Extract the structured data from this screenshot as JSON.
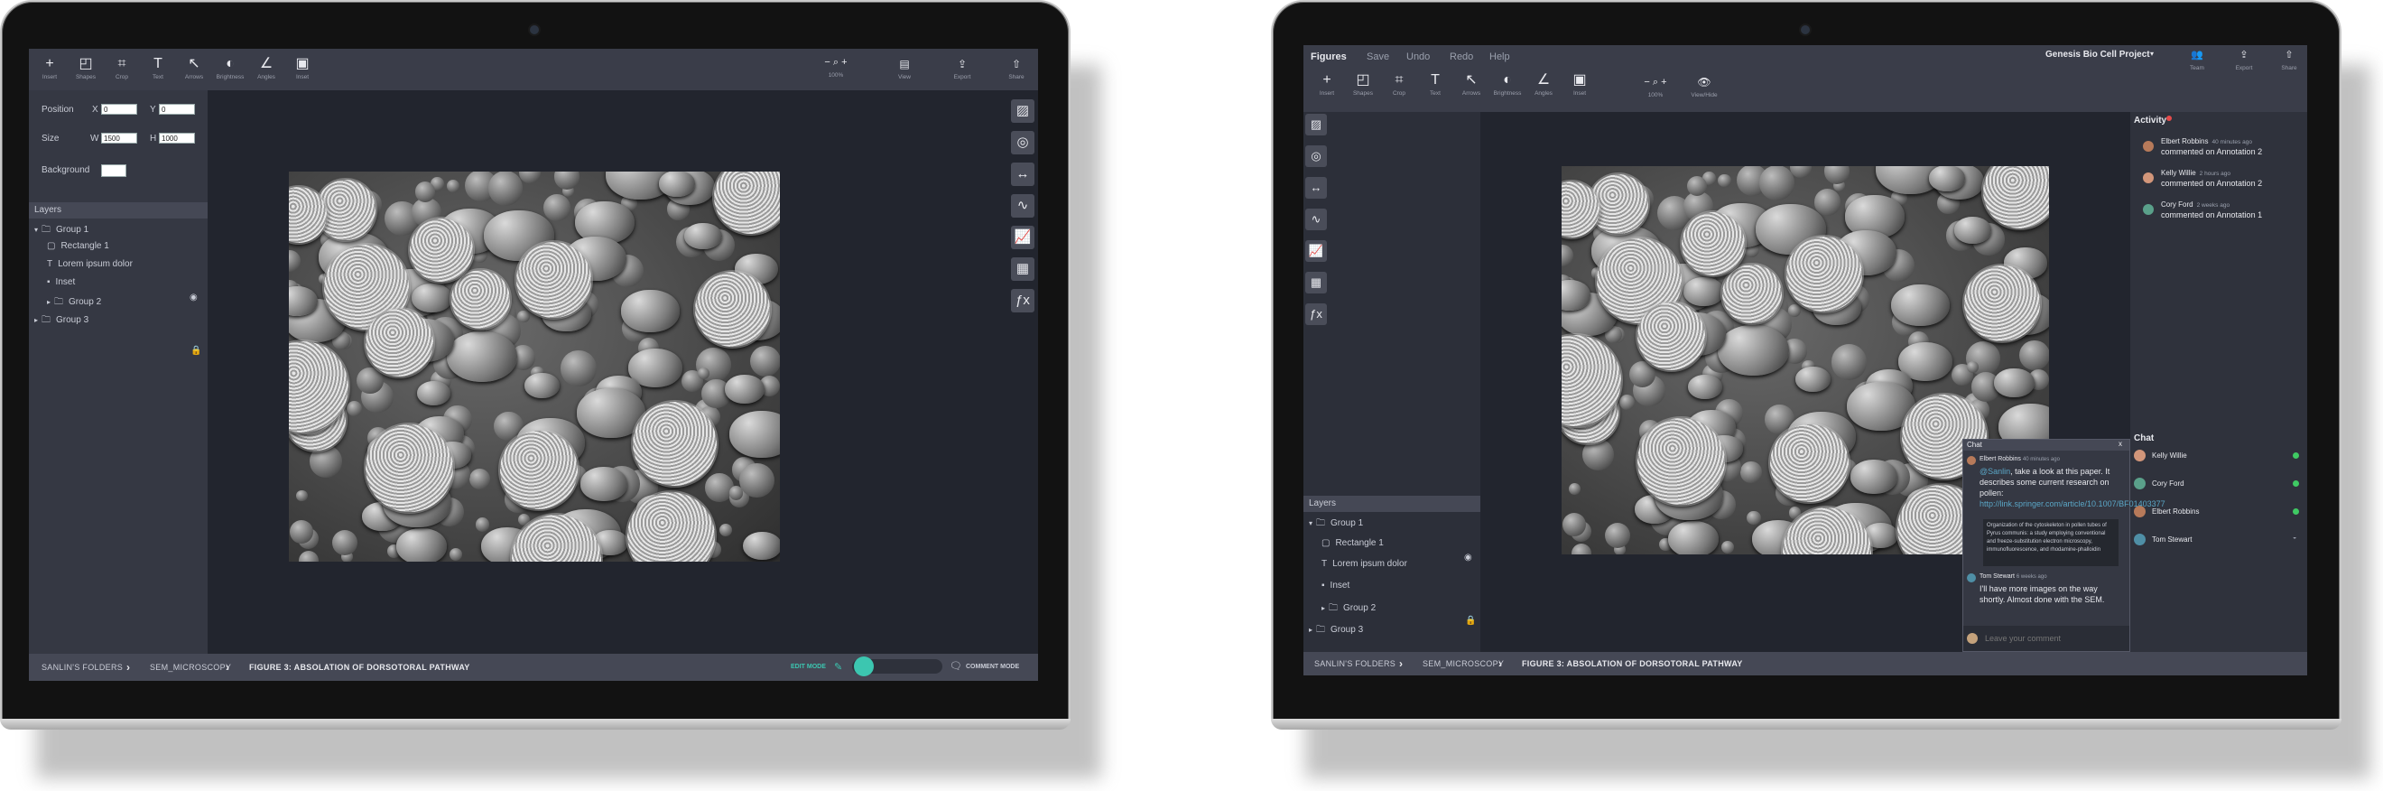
{
  "left": {
    "toolbar": [
      {
        "icon": "insert-icon",
        "glyph": "+",
        "label": "Insert"
      },
      {
        "icon": "shapes-icon",
        "glyph": "◰",
        "label": "Shapes"
      },
      {
        "icon": "crop-icon",
        "glyph": "⌗",
        "label": "Crop"
      },
      {
        "icon": "text-icon",
        "glyph": "T",
        "label": "Text"
      },
      {
        "icon": "arrows-icon",
        "glyph": "↖",
        "label": "Arrows"
      },
      {
        "icon": "brightness-icon",
        "glyph": "◐",
        "label": "Brightness"
      },
      {
        "icon": "angles-icon",
        "glyph": "∠",
        "label": "Angles"
      },
      {
        "icon": "inset-icon",
        "glyph": "▣",
        "label": "Inset"
      }
    ],
    "zoom": {
      "minus": "−",
      "plus": "+",
      "value": "100%"
    },
    "right_tools": [
      {
        "icon": "view-icon",
        "glyph": "▤",
        "label": "View"
      },
      {
        "icon": "export-icon",
        "glyph": "⇪",
        "label": "Export"
      },
      {
        "icon": "share-icon",
        "glyph": "⇧",
        "label": "Share"
      }
    ],
    "props": {
      "position_label": "Position",
      "x_label": "X",
      "x_value": "0",
      "y_label": "Y",
      "y_value": "0",
      "size_label": "Size",
      "w_label": "W",
      "w_value": "1500",
      "h_label": "H",
      "h_value": "1000",
      "background_label": "Background"
    },
    "layers_title": "Layers",
    "layers": [
      {
        "name": "Group 1",
        "icon": "folder-icon",
        "arrow": "▾"
      },
      {
        "name": "Rectangle 1",
        "icon": "rectangle-icon"
      },
      {
        "name": "Lorem ipsum dolor",
        "icon": "text-icon"
      },
      {
        "name": "Inset",
        "icon": "inset-icon"
      },
      {
        "name": "Group 2",
        "icon": "folder-icon",
        "arrow": "▸"
      },
      {
        "name": "Group 3",
        "icon": "folder-icon",
        "arrow": "▸"
      }
    ],
    "breadcrumbs": [
      "SANLIN'S FOLDERS",
      "SEM_MICROSCOPY",
      "FIGURE 3: ABSOLATION OF DORSOTORAL PATHWAY"
    ],
    "edit_mode": "EDIT MODE",
    "comment_mode": "COMMENT MODE"
  },
  "right": {
    "menu": [
      "Figures",
      "Save",
      "Undo",
      "Redo",
      "Help"
    ],
    "project": "Genesis Bio Cell Project",
    "header_tools": [
      {
        "icon": "team-icon",
        "glyph": "👥",
        "label": "Team"
      },
      {
        "icon": "export-icon",
        "glyph": "⇪",
        "label": "Export"
      },
      {
        "icon": "share-icon",
        "glyph": "⇧",
        "label": "Share"
      }
    ],
    "toolbar": [
      {
        "icon": "insert-icon",
        "glyph": "+",
        "label": "Insert"
      },
      {
        "icon": "shapes-icon",
        "glyph": "◰",
        "label": "Shapes"
      },
      {
        "icon": "crop-icon",
        "glyph": "⌗",
        "label": "Crop"
      },
      {
        "icon": "text-icon",
        "glyph": "T",
        "label": "Text"
      },
      {
        "icon": "arrows-icon",
        "glyph": "↖",
        "label": "Arrows"
      },
      {
        "icon": "brightness-icon",
        "glyph": "◐",
        "label": "Brightness"
      },
      {
        "icon": "angles-icon",
        "glyph": "∠",
        "label": "Angles"
      },
      {
        "icon": "inset-icon",
        "glyph": "▣",
        "label": "Inset"
      }
    ],
    "zoom": {
      "minus": "−",
      "plus": "+",
      "value": "100%"
    },
    "viewhide": {
      "glyph": "👁",
      "label": "View/Hide"
    },
    "activity_title": "Activity",
    "activity": [
      {
        "name": "Elbert Robbins",
        "time": "40 minutes ago",
        "text": "commented on Annotation 2",
        "color": "#b77a5a"
      },
      {
        "name": "Kelly Willie",
        "time": "2 hours ago",
        "text": "commented on Annotation 2",
        "color": "#d2967a"
      },
      {
        "name": "Cory Ford",
        "time": "2 weeks ago",
        "text": "commented on Annotation 1",
        "color": "#5aa08a"
      }
    ],
    "chat_title": "Chat",
    "chat_users": [
      {
        "name": "Kelly Willie",
        "color": "#d2967a",
        "online": true
      },
      {
        "name": "Cory Ford",
        "color": "#5aa08a",
        "online": true
      },
      {
        "name": "Elbert Robbins",
        "color": "#b77a5a",
        "online": true
      },
      {
        "name": "Tom Stewart",
        "color": "#4f8fa6",
        "online": false
      }
    ],
    "chat_popup": {
      "title": "Chat",
      "close": "x",
      "msg1_name": "Elbert Robbins",
      "msg1_time": "40 minutes ago",
      "msg1_mention": "@Sanlin",
      "msg1_text": ", take a look at this paper. It describes some current research on pollen: ",
      "msg1_link": "http://link.springer.com/article/10.1007/BF01403377",
      "quote": "Organization of the cytoskeleton in pollen tubes of Pyrus communis: a study employing conventional and freeze-substitution electron microscopy, immunofluorescence, and rhodamine-phalloidin",
      "msg2_name": "Tom Stewart",
      "msg2_time": "6 weeks ago",
      "msg2_text": "I'll have more images on the way shortly. Almost done with the SEM.",
      "placeholder": "Leave your comment"
    },
    "layers_title": "Layers",
    "layers": [
      {
        "name": "Group 1",
        "arrow": "▾"
      },
      {
        "name": "Rectangle 1"
      },
      {
        "name": "Lorem ipsum dolor"
      },
      {
        "name": "Inset"
      },
      {
        "name": "Group 2",
        "arrow": "▸"
      },
      {
        "name": "Group 3",
        "arrow": "▸"
      }
    ],
    "breadcrumbs": [
      "SANLIN'S FOLDERS",
      "SEM_MICROSCOPY",
      "FIGURE 3: ABSOLATION OF DORSOTORAL PATHWAY"
    ]
  },
  "side_tools": [
    {
      "icon": "image-icon",
      "glyph": "▨"
    },
    {
      "icon": "annotation-icon",
      "glyph": "◎"
    },
    {
      "icon": "measure-icon",
      "glyph": "↔"
    },
    {
      "icon": "line-graph-icon",
      "glyph": "∿"
    },
    {
      "icon": "chart-icon",
      "glyph": "📈"
    },
    {
      "icon": "grid-icon",
      "glyph": "▦"
    },
    {
      "icon": "function-icon",
      "glyph": "ƒx"
    }
  ],
  "colors": {
    "accent": "#3cc6b0",
    "bg": "#22252e",
    "panel": "#353843",
    "toolbar": "#3a3d49"
  }
}
